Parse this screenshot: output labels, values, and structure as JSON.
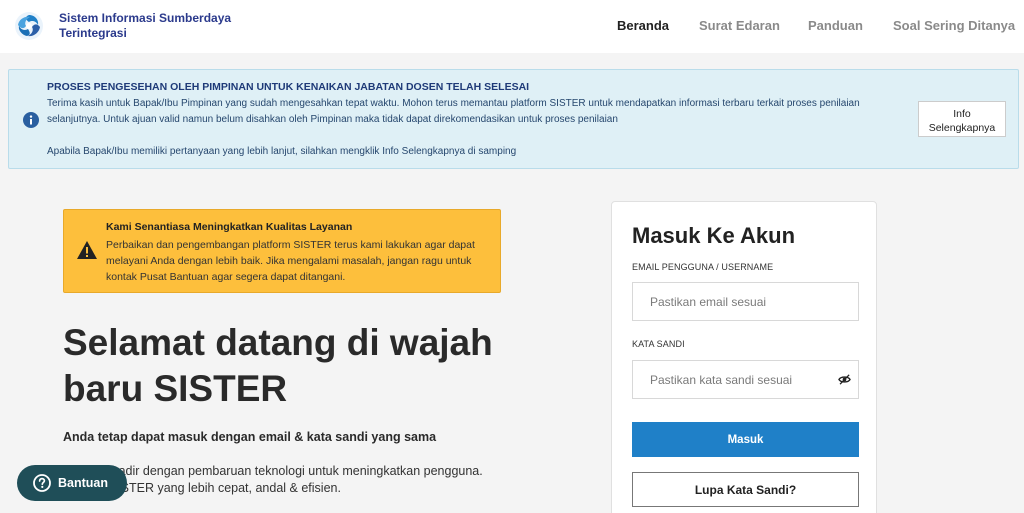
{
  "header": {
    "brand": "Sistem Informasi Sumberdaya Terintegrasi",
    "nav": [
      "Beranda",
      "Surat Edaran",
      "Panduan",
      "Soal Sering Ditanya"
    ],
    "active_nav": "Beranda"
  },
  "info_banner": {
    "title": "PROSES PENGESEHAN OLEH PIMPINAN UNTUK KENAIKAN JABATAN DOSEN TELAH SELESAI",
    "text": "Terima kasih untuk Bapak/Ibu Pimpinan yang sudah mengesahkan tepat waktu. Mohon terus memantau platform SISTER untuk mendapatkan informasi terbaru terkait proses penilaian selanjutnya. Untuk ajuan valid namun belum disahkan oleh Pimpinan maka tidak dapat direkomendasikan untuk proses penilaian",
    "text2": "Apabila Bapak/Ibu memiliki pertanyaan yang lebih lanjut, silahkan mengklik Info Selengkapnya di samping",
    "button_label": "Info Selengkapnya"
  },
  "notice": {
    "title": "Kami Senantiasa Meningkatkan Kualitas Layanan",
    "text": "Perbaikan dan pengembangan platform SISTER terus kami lakukan agar dapat melayani Anda dengan lebih baik. Jika mengalami masalah, jangan ragu untuk kontak Pusat Bantuan agar segera dapat ditangani."
  },
  "welcome": {
    "heading": "Selamat datang di wajah baru SISTER",
    "subheading": "Anda tetap dapat masuk dengan email & kata sandi yang sama",
    "description": "SISTER hadir dengan pembaruan teknologi untuk meningkatkan pengguna. Jelajahi SISTER yang lebih cepat, andal & efisien."
  },
  "help": {
    "label": "Bantuan"
  },
  "login": {
    "title": "Masuk Ke Akun",
    "email_label": "EMAIL PENGGUNA / USERNAME",
    "email_placeholder": "Pastikan email sesuai",
    "email_value": "",
    "password_label": "KATA SANDI",
    "password_placeholder": "Pastikan kata sandi sesuai",
    "password_value": "",
    "submit_label": "Masuk",
    "forgot_label": "Lupa Kata Sandi?"
  },
  "colors": {
    "primary": "#1f80c8",
    "info_bg": "#dff0f6",
    "warning_bg": "#fdbf3c",
    "help_bg": "#1f4e58",
    "brand_text": "#2b3a8c"
  },
  "icons": {
    "logo": "sister-logo-icon",
    "info": "info-circle-icon",
    "warning": "warning-triangle-icon",
    "help": "question-circle-icon",
    "password_toggle": "eye-slash-icon"
  }
}
